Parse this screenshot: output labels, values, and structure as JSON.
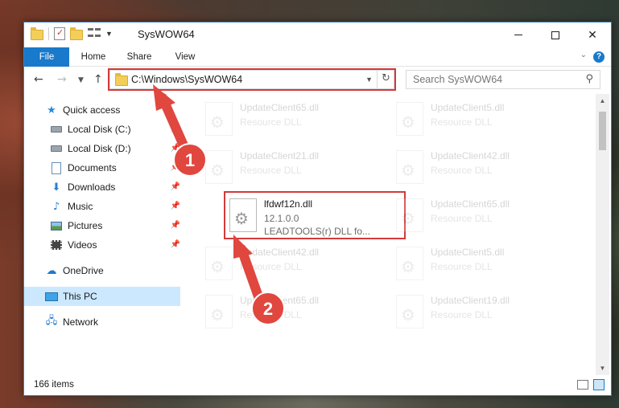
{
  "window": {
    "title": "SysWOW64"
  },
  "ribbon": {
    "tabs": [
      {
        "label": "File"
      },
      {
        "label": "Home"
      },
      {
        "label": "Share"
      },
      {
        "label": "View"
      }
    ],
    "help": "?"
  },
  "nav": {
    "back": "←",
    "forward": "→",
    "recent": "⌄",
    "up": "↑",
    "address": "C:\\Windows\\SysWOW64",
    "refresh": "↻"
  },
  "search": {
    "placeholder": "Search SysWOW64",
    "icon": "search-icon"
  },
  "sidebar": {
    "items": [
      {
        "label": "Quick access",
        "icon": "star-icon"
      },
      {
        "label": "Local Disk (C:)",
        "icon": "drive-icon",
        "pinned": true
      },
      {
        "label": "Local Disk (D:)",
        "icon": "drive-icon",
        "pinned": true
      },
      {
        "label": "Documents",
        "icon": "documents-icon",
        "pinned": true
      },
      {
        "label": "Downloads",
        "icon": "download-icon",
        "pinned": true
      },
      {
        "label": "Music",
        "icon": "music-icon",
        "pinned": true
      },
      {
        "label": "Pictures",
        "icon": "pictures-icon",
        "pinned": true
      },
      {
        "label": "Videos",
        "icon": "videos-icon",
        "pinned": true
      },
      {
        "label": "OneDrive",
        "icon": "cloud-icon"
      },
      {
        "label": "This PC",
        "icon": "computer-icon",
        "selected": true
      },
      {
        "label": "Network",
        "icon": "network-icon"
      }
    ]
  },
  "files": [
    {
      "name": "UpdateClient65.dll",
      "type": "Resource DLL"
    },
    {
      "name": "UpdateClient5.dll",
      "type": "Resource DLL"
    },
    {
      "name": "UpdateClient21.dll",
      "type": "Resource DLL"
    },
    {
      "name": "UpdateClient42.dll",
      "type": "Resource DLL"
    },
    {
      "name": "lfdwf12n.dll",
      "version": "12.1.0.0",
      "description": "LEADTOOLS(r) DLL fo..."
    },
    {
      "name": "UpdateClient65.dll",
      "type": "Resource DLL"
    },
    {
      "name": "UpdateClient42.dll",
      "type": "Resource DLL"
    },
    {
      "name": "UpdateClient5.dll",
      "type": "Resource DLL"
    },
    {
      "name": "UpdateClient65.dll",
      "type": "Resource DLL"
    },
    {
      "name": "UpdateClient19.dll",
      "type": "Resource DLL"
    }
  ],
  "status": {
    "item_count": "166 items"
  },
  "annotations": {
    "step1": "1",
    "step2": "2",
    "color": "#e0473f"
  },
  "colors": {
    "accent": "#1979ca",
    "highlight": "#d23a3a",
    "selected": "#cce8ff"
  }
}
